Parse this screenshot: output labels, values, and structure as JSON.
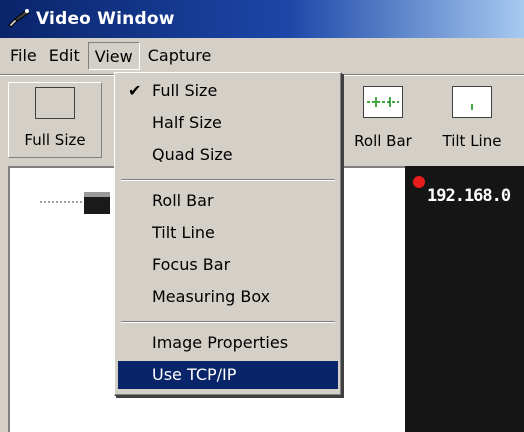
{
  "window": {
    "title": "Video Window"
  },
  "menubar": {
    "items": [
      "File",
      "Edit",
      "View",
      "Capture"
    ],
    "open_menu": "View"
  },
  "toolbar": {
    "buttons": [
      {
        "label": "Full Size",
        "icon": "full-size-icon"
      },
      {
        "label": "Roll Bar",
        "icon": "roll-bar-icon"
      },
      {
        "label": "Tilt Line",
        "icon": "tilt-line-icon"
      }
    ]
  },
  "view_menu": {
    "items": [
      {
        "label": "Full Size",
        "checked": true
      },
      {
        "label": "Half Size",
        "checked": false
      },
      {
        "label": "Quad Size",
        "checked": false
      },
      {
        "label": "Roll Bar",
        "checked": false
      },
      {
        "label": "Tilt Line",
        "checked": false
      },
      {
        "label": "Focus Bar",
        "checked": false
      },
      {
        "label": "Measuring Box",
        "checked": false
      },
      {
        "label": "Image Properties",
        "checked": false
      },
      {
        "label": "Use TCP/IP",
        "checked": false,
        "highlighted": true
      }
    ],
    "check_glyph": "✔"
  },
  "video": {
    "overlay_text": "192.168.0",
    "recording_indicator_color": "#e81c1c"
  },
  "colors": {
    "title_bar": "#0a246a",
    "menu_highlight": "#0a246a",
    "face": "#d4d0c8"
  }
}
